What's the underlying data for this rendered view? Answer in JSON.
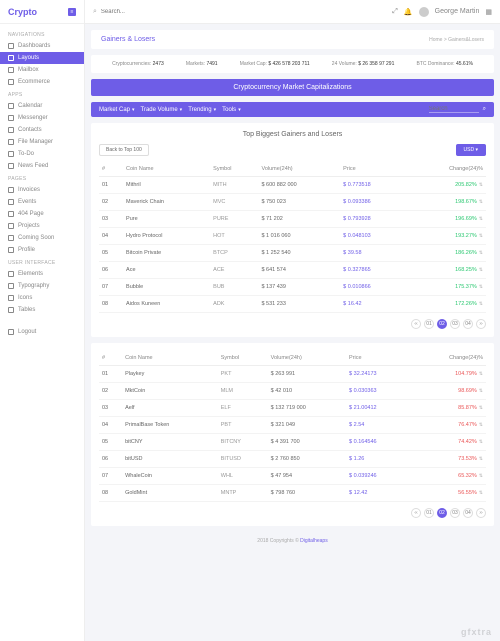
{
  "brand": "Crypto",
  "user_name": "George Martin",
  "search_placeholder": "Search...",
  "page": {
    "title": "Gainers & Losers",
    "crumb_home": "Home",
    "crumb_current": "Gainers&Losers"
  },
  "stats": {
    "cc_label": "Cryptocurrencies:",
    "cc_val": "2473",
    "mk_label": "Markets:",
    "mk_val": "7491",
    "cap_label": "Market Cap:",
    "cap_val": "$ 426 578 203 711",
    "vol_label": "24 Volume:",
    "vol_val": "$ 26 358 97 291",
    "dom_label": "BTC Dominance:",
    "dom_val": "45.61%"
  },
  "banner": "Cryptocurrency Market Capitalizations",
  "toolbar": {
    "cap": "Market Cap",
    "vol": "Trade Volume",
    "trend": "Trending",
    "tools": "Tools",
    "search": "Search"
  },
  "card_title": "Top Biggest Gainers and Losers",
  "btn_back": "Back to Top 100",
  "btn_usd": "USD",
  "thead": {
    "num": "#",
    "name": "Coin Name",
    "sym": "Symbol",
    "vol": "Volume(24h)",
    "price": "Price",
    "chg": "Change(24)%"
  },
  "gainers": [
    {
      "n": "01",
      "name": "Mithril",
      "sym": "MITH",
      "vol": "$ 600 882 000",
      "price": "$ 0.773518",
      "chg": "205.82%"
    },
    {
      "n": "02",
      "name": "Maverick Chain",
      "sym": "MVC",
      "vol": "$ 750 023",
      "price": "$ 0.093386",
      "chg": "198.67%"
    },
    {
      "n": "03",
      "name": "Pure",
      "sym": "PURE",
      "vol": "$ 71 202",
      "price": "$ 0.793928",
      "chg": "196.69%"
    },
    {
      "n": "04",
      "name": "Hydro Protocol",
      "sym": "HOT",
      "vol": "$ 1 016 060",
      "price": "$ 0.048103",
      "chg": "193.27%"
    },
    {
      "n": "05",
      "name": "Bitcoin Private",
      "sym": "BTCP",
      "vol": "$ 1 252 540",
      "price": "$ 39.58",
      "chg": "186.26%"
    },
    {
      "n": "06",
      "name": "Ace",
      "sym": "ACE",
      "vol": "$ 641 574",
      "price": "$ 0.327865",
      "chg": "168.25%"
    },
    {
      "n": "07",
      "name": "Bubble",
      "sym": "BUB",
      "vol": "$ 137 439",
      "price": "$ 0.010866",
      "chg": "175.37%"
    },
    {
      "n": "08",
      "name": "Aidos Kuneen",
      "sym": "ADK",
      "vol": "$ 531 233",
      "price": "$ 16.42",
      "chg": "172.26%"
    }
  ],
  "losers": [
    {
      "n": "01",
      "name": "Playkey",
      "sym": "PKT",
      "vol": "$ 263 991",
      "price": "$ 32.24173",
      "chg": "104.79%"
    },
    {
      "n": "02",
      "name": "MktCoin",
      "sym": "MLM",
      "vol": "$ 42 010",
      "price": "$ 0.030363",
      "chg": "98.69%"
    },
    {
      "n": "03",
      "name": "Aelf",
      "sym": "ELF",
      "vol": "$ 132 719 000",
      "price": "$ 21.00412",
      "chg": "85.87%"
    },
    {
      "n": "04",
      "name": "PrimalBase Token",
      "sym": "PBT",
      "vol": "$ 321 049",
      "price": "$ 2.54",
      "chg": "76.47%"
    },
    {
      "n": "05",
      "name": "bitCNY",
      "sym": "BITCNY",
      "vol": "$ 4 391 700",
      "price": "$ 0.164546",
      "chg": "74.42%"
    },
    {
      "n": "06",
      "name": "bitUSD",
      "sym": "BITUSD",
      "vol": "$ 2 760 850",
      "price": "$ 1.26",
      "chg": "73.53%"
    },
    {
      "n": "07",
      "name": "WhaleCoin",
      "sym": "WHL",
      "vol": "$ 47 954",
      "price": "$ 0.039246",
      "chg": "65.32%"
    },
    {
      "n": "08",
      "name": "GoldMint",
      "sym": "MNTP",
      "vol": "$ 798 760",
      "price": "$ 12.42",
      "chg": "56.55%"
    }
  ],
  "pages": [
    "01",
    "02",
    "03",
    "04"
  ],
  "nav": {
    "navigation": "NAVIGATIONS",
    "dashboards": "Dashboards",
    "layouts": "Layouts",
    "mailbox": "Mailbox",
    "ecommerce": "Ecommerce",
    "apps": "APPS",
    "calendar": "Calendar",
    "messenger": "Messenger",
    "contacts": "Contacts",
    "filemanager": "File Manager",
    "todo": "To-Do",
    "newsfeed": "News Feed",
    "pages": "PAGES",
    "invoices": "Invoices",
    "events": "Events",
    "p404": "404 Page",
    "projects": "Projects",
    "coming": "Coming Soon",
    "profile": "Profile",
    "ui": "USER INTERFACE",
    "elements": "Elements",
    "typography": "Typography",
    "icons": "Icons",
    "tables": "Tables",
    "logout": "Logout"
  },
  "footer": {
    "year": "2018 Copyrights ©",
    "link": "Digitalheaps"
  }
}
